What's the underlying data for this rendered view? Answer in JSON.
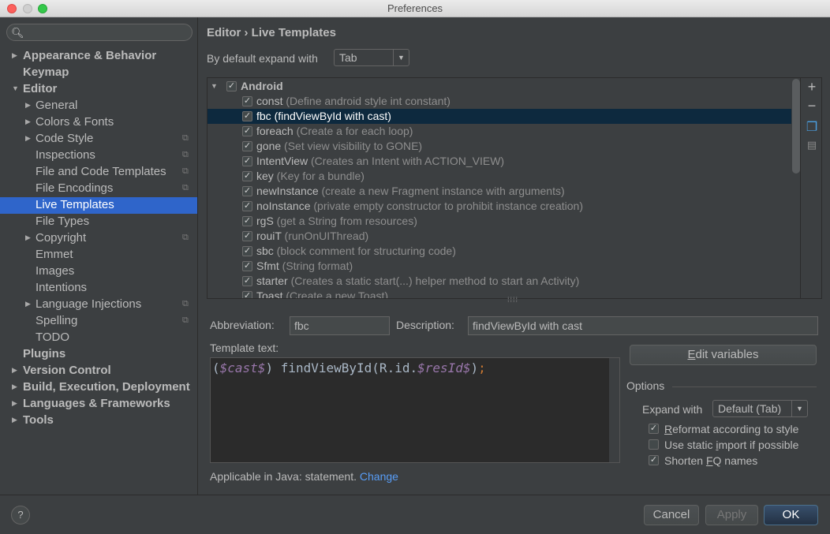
{
  "window": {
    "title": "Preferences"
  },
  "sidebar": {
    "search_placeholder": "",
    "items": [
      {
        "label": "Appearance & Behavior",
        "arrow": "▶"
      },
      {
        "label": "Keymap",
        "arrow": ""
      },
      {
        "label": "Editor",
        "arrow": "▼"
      },
      {
        "label": "General",
        "arrow": "▶"
      },
      {
        "label": "Colors & Fonts",
        "arrow": "▶"
      },
      {
        "label": "Code Style",
        "arrow": "▶"
      },
      {
        "label": "Inspections",
        "arrow": ""
      },
      {
        "label": "File and Code Templates",
        "arrow": ""
      },
      {
        "label": "File Encodings",
        "arrow": ""
      },
      {
        "label": "Live Templates",
        "arrow": ""
      },
      {
        "label": "File Types",
        "arrow": ""
      },
      {
        "label": "Copyright",
        "arrow": "▶"
      },
      {
        "label": "Emmet",
        "arrow": ""
      },
      {
        "label": "Images",
        "arrow": ""
      },
      {
        "label": "Intentions",
        "arrow": ""
      },
      {
        "label": "Language Injections",
        "arrow": "▶"
      },
      {
        "label": "Spelling",
        "arrow": ""
      },
      {
        "label": "TODO",
        "arrow": ""
      },
      {
        "label": "Plugins",
        "arrow": ""
      },
      {
        "label": "Version Control",
        "arrow": "▶"
      },
      {
        "label": "Build, Execution, Deployment",
        "arrow": "▶"
      },
      {
        "label": "Languages & Frameworks",
        "arrow": "▶"
      },
      {
        "label": "Tools",
        "arrow": "▶"
      }
    ]
  },
  "main": {
    "breadcrumb": "Editor › Live Templates",
    "expand_label": "By default expand with",
    "expand_value": "Tab",
    "group": {
      "name": "Android"
    },
    "templates": [
      {
        "name": "const",
        "desc": " (Define android style int constant)"
      },
      {
        "name": "fbc",
        "desc": " (findViewById with cast)"
      },
      {
        "name": "foreach",
        "desc": " (Create a for each loop)"
      },
      {
        "name": "gone",
        "desc": " (Set view visibility to GONE)"
      },
      {
        "name": "IntentView",
        "desc": " (Creates an Intent with ACTION_VIEW)"
      },
      {
        "name": "key",
        "desc": " (Key for a bundle)"
      },
      {
        "name": "newInstance",
        "desc": " (create a new Fragment instance with arguments)"
      },
      {
        "name": "noInstance",
        "desc": " (private empty constructor to prohibit instance creation)"
      },
      {
        "name": "rgS",
        "desc": " (get a String from resources)"
      },
      {
        "name": "rouiT",
        "desc": " (runOnUIThread)"
      },
      {
        "name": "sbc",
        "desc": " (block comment for structuring code)"
      },
      {
        "name": "Sfmt",
        "desc": " (String format)"
      },
      {
        "name": "starter",
        "desc": " (Creates a static start(...) helper method to start an Activity)"
      },
      {
        "name": "Toast",
        "desc": " (Create a new Toast)"
      }
    ],
    "abbreviation_label": "Abbreviation:",
    "abbreviation_value": "fbc",
    "description_label": "Description:",
    "description_value": "findViewById with cast",
    "template_text_label": "Template text:",
    "code": {
      "p1": "(",
      "v1": "$cast$",
      "p2": ") findViewById(R.id.",
      "v2": "$resId$",
      "p3": ")",
      "semi": ";"
    },
    "edit_variables": {
      "pre": "",
      "u": "E",
      "post": "dit variables"
    },
    "options_title": "Options",
    "expand_with_label": "Expand with",
    "expand_with_value": "Default (Tab)",
    "opt_reformat": {
      "pre": "",
      "u": "R",
      "post": "eformat according to style"
    },
    "opt_static": {
      "pre": "Use static ",
      "u": "i",
      "post": "mport if possible"
    },
    "opt_shorten": {
      "pre": "Shorten ",
      "u": "F",
      "post": "Q names"
    },
    "applicable_text": "Applicable in Java: statement.",
    "change_link": "Change"
  },
  "footer": {
    "help": "?",
    "cancel": "Cancel",
    "apply": "Apply",
    "ok": "OK"
  },
  "colors": {
    "accent": "#2f65ca",
    "selection_row": "#0d293e",
    "link": "#589df6"
  }
}
